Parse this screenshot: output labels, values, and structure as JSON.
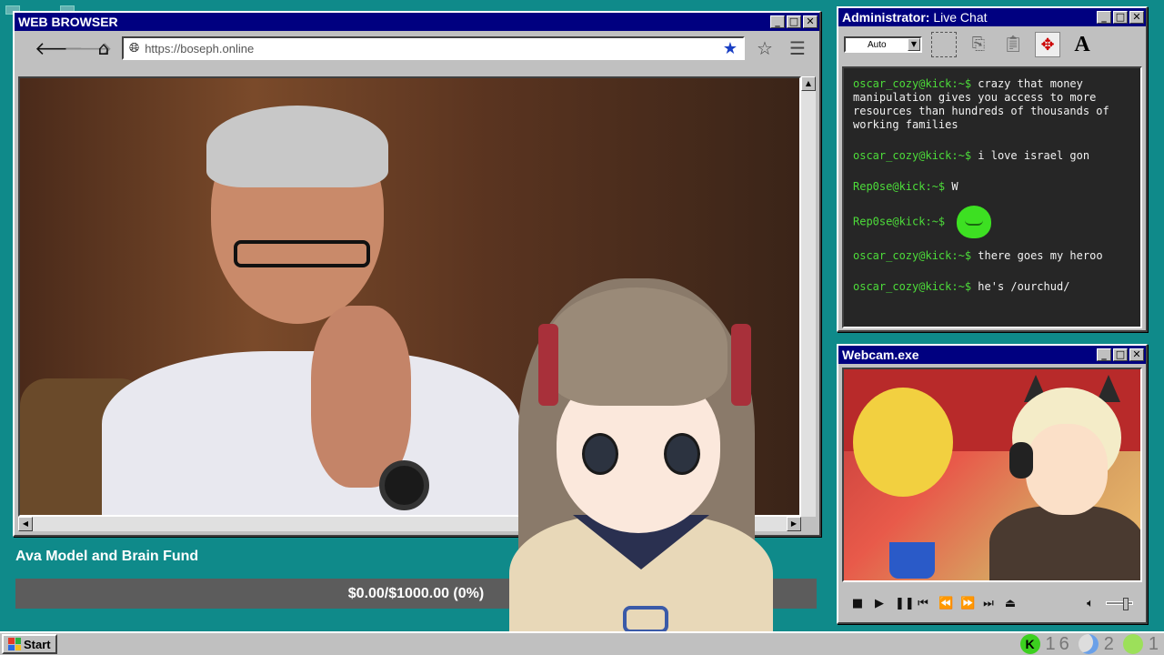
{
  "browser": {
    "title": "WEB BROWSER",
    "url": "https://boseph.online"
  },
  "fund": {
    "title": "Ava Model and Brain Fund",
    "progress_label": "$0.00/$1000.00 (0%)",
    "progress_fraction": 0
  },
  "chat": {
    "title_prefix": "Administrator:",
    "title_suffix": "Live Chat",
    "mode": "Auto",
    "messages": [
      {
        "user": "oscar_cozy@kick:~$",
        "text": "crazy that money manipulation gives you access to more resources than hundreds of thousands of working families"
      },
      {
        "user": "oscar_cozy@kick:~$",
        "text": "i love israel gon"
      },
      {
        "user": "Rep0se@kick:~$",
        "text": "W"
      },
      {
        "user": "Rep0se@kick:~$",
        "text": ""
      },
      {
        "user": "oscar_cozy@kick:~$",
        "text": "there goes my heroo"
      },
      {
        "user": "oscar_cozy@kick:~$",
        "text": "he's /ourchud/"
      }
    ]
  },
  "webcam": {
    "title": "Webcam.exe"
  },
  "taskbar": {
    "start_label": "Start",
    "tray_count_1": "16",
    "tray_count_2": "2",
    "tray_count_3": "1"
  },
  "colors": {
    "desktop": "#0f8a8a",
    "titlebar": "#000080",
    "chat_user": "#4ddc3a",
    "progress_bg": "#5c5c5c"
  },
  "icons": {
    "back": "arrow-left-icon",
    "forward": "arrow-right-icon",
    "home": "home-icon",
    "globe": "globe-icon",
    "bookmark_filled": "star-filled-icon",
    "bookmark": "star-outline-icon",
    "menu": "hamburger-menu-icon"
  }
}
